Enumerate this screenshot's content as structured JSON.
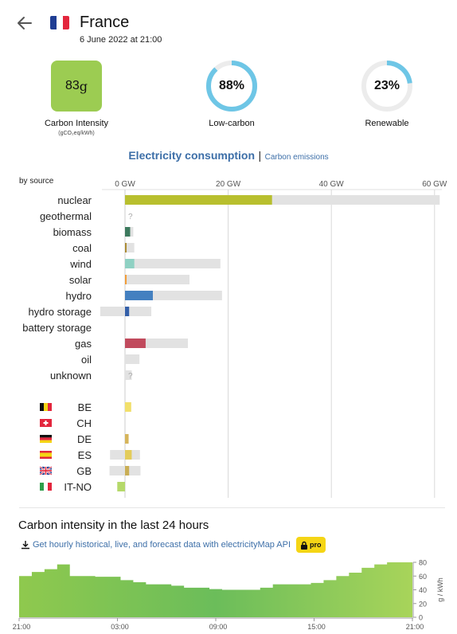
{
  "header": {
    "country": "France",
    "datetime": "6 June 2022 at 21:00",
    "flag_colors": [
      "#1f3d93",
      "#ffffff",
      "#e3263d"
    ]
  },
  "kpis": {
    "carbon_intensity": {
      "value": "83",
      "unit": "g",
      "label": "Carbon Intensity",
      "sublabel": "(gCO₂eq/kWh)",
      "color": "#9ccc52"
    },
    "low_carbon": {
      "value": "88%",
      "label": "Low-carbon",
      "fraction": 0.88
    },
    "renewable": {
      "value": "23%",
      "label": "Renewable",
      "fraction": 0.23
    },
    "ring_color": "#6ec6e6"
  },
  "tabs": {
    "active": "Electricity consumption",
    "separator": "|",
    "inactive": "Carbon emissions"
  },
  "chart_data": {
    "type": "bar",
    "title": "by source",
    "xlim": [
      -2.6,
      61
    ],
    "x_ticks": [
      {
        "v": 0,
        "label": "0 GW"
      },
      {
        "v": 20,
        "label": "20 GW"
      },
      {
        "v": 40,
        "label": "40 GW"
      },
      {
        "v": 60,
        "label": "60 GW"
      }
    ],
    "sources": [
      {
        "name": "nuclear",
        "production": 28.5,
        "capacity": 61,
        "color": "#b8bf2e"
      },
      {
        "name": "geothermal",
        "production": 0,
        "capacity": 0,
        "color": "#cccccc",
        "unknown": true
      },
      {
        "name": "biomass",
        "production": 1.0,
        "capacity": 1.6,
        "color": "#3d7a5e"
      },
      {
        "name": "coal",
        "production": 0.1,
        "capacity": 1.8,
        "color": "#ac8c35"
      },
      {
        "name": "wind",
        "production": 1.8,
        "capacity": 18.5,
        "color": "#8fd1c3"
      },
      {
        "name": "solar",
        "production": 0.3,
        "capacity": 12.5,
        "color": "#f29d38"
      },
      {
        "name": "hydro",
        "production": 5.4,
        "capacity": 18.8,
        "color": "#4480c0"
      },
      {
        "name": "hydro storage",
        "production": 0.8,
        "capacity": 5.1,
        "color": "#3560a9",
        "negative": -4.8
      },
      {
        "name": "battery storage",
        "production": 0,
        "capacity": 0,
        "color": "#cccccc"
      },
      {
        "name": "gas",
        "production": 4.0,
        "capacity": 12.2,
        "color": "#c14a5d"
      },
      {
        "name": "oil",
        "production": 0,
        "capacity": 2.8,
        "color": "#867d66"
      },
      {
        "name": "unknown",
        "production": 0,
        "capacity": 1.3,
        "color": "#cccccc",
        "unknown": true
      }
    ],
    "exchanges": [
      {
        "name": "BE",
        "value": 1.2,
        "capacity": 1.2,
        "color": "#f2e06b"
      },
      {
        "name": "CH",
        "value": 0,
        "capacity": 0,
        "color": "#f2e06b"
      },
      {
        "name": "DE",
        "value": 0.7,
        "capacity": 0.7,
        "color": "#d6b55a"
      },
      {
        "name": "ES",
        "value": 1.3,
        "capacity": 2.9,
        "color": "#e3cc5a",
        "negative": -2.9
      },
      {
        "name": "GB",
        "value": 0.8,
        "capacity": 3.0,
        "color": "#c9ae55",
        "negative": -3.0
      },
      {
        "name": "IT-NO",
        "value": -1.5,
        "capacity": -1.5,
        "color": "#b5d96a"
      }
    ]
  },
  "history": {
    "title": "Carbon intensity in the last 24 hours",
    "link": "Get hourly historical, live, and forecast data with electricityMap API",
    "pro_label": "pro",
    "x_labels": [
      "21:00",
      "03:00",
      "09:00",
      "15:00",
      "21:00"
    ],
    "y_ticks": [
      "80",
      "60",
      "40",
      "20",
      "0"
    ],
    "y_unit": "g / kWh",
    "ymax": 80,
    "values": [
      60,
      66,
      70,
      77,
      60,
      60,
      59,
      59,
      54,
      51,
      48,
      48,
      46,
      43,
      43,
      41,
      40,
      40,
      40,
      43,
      48,
      48,
      48,
      50,
      54,
      60,
      65,
      72,
      77,
      80,
      80
    ]
  }
}
